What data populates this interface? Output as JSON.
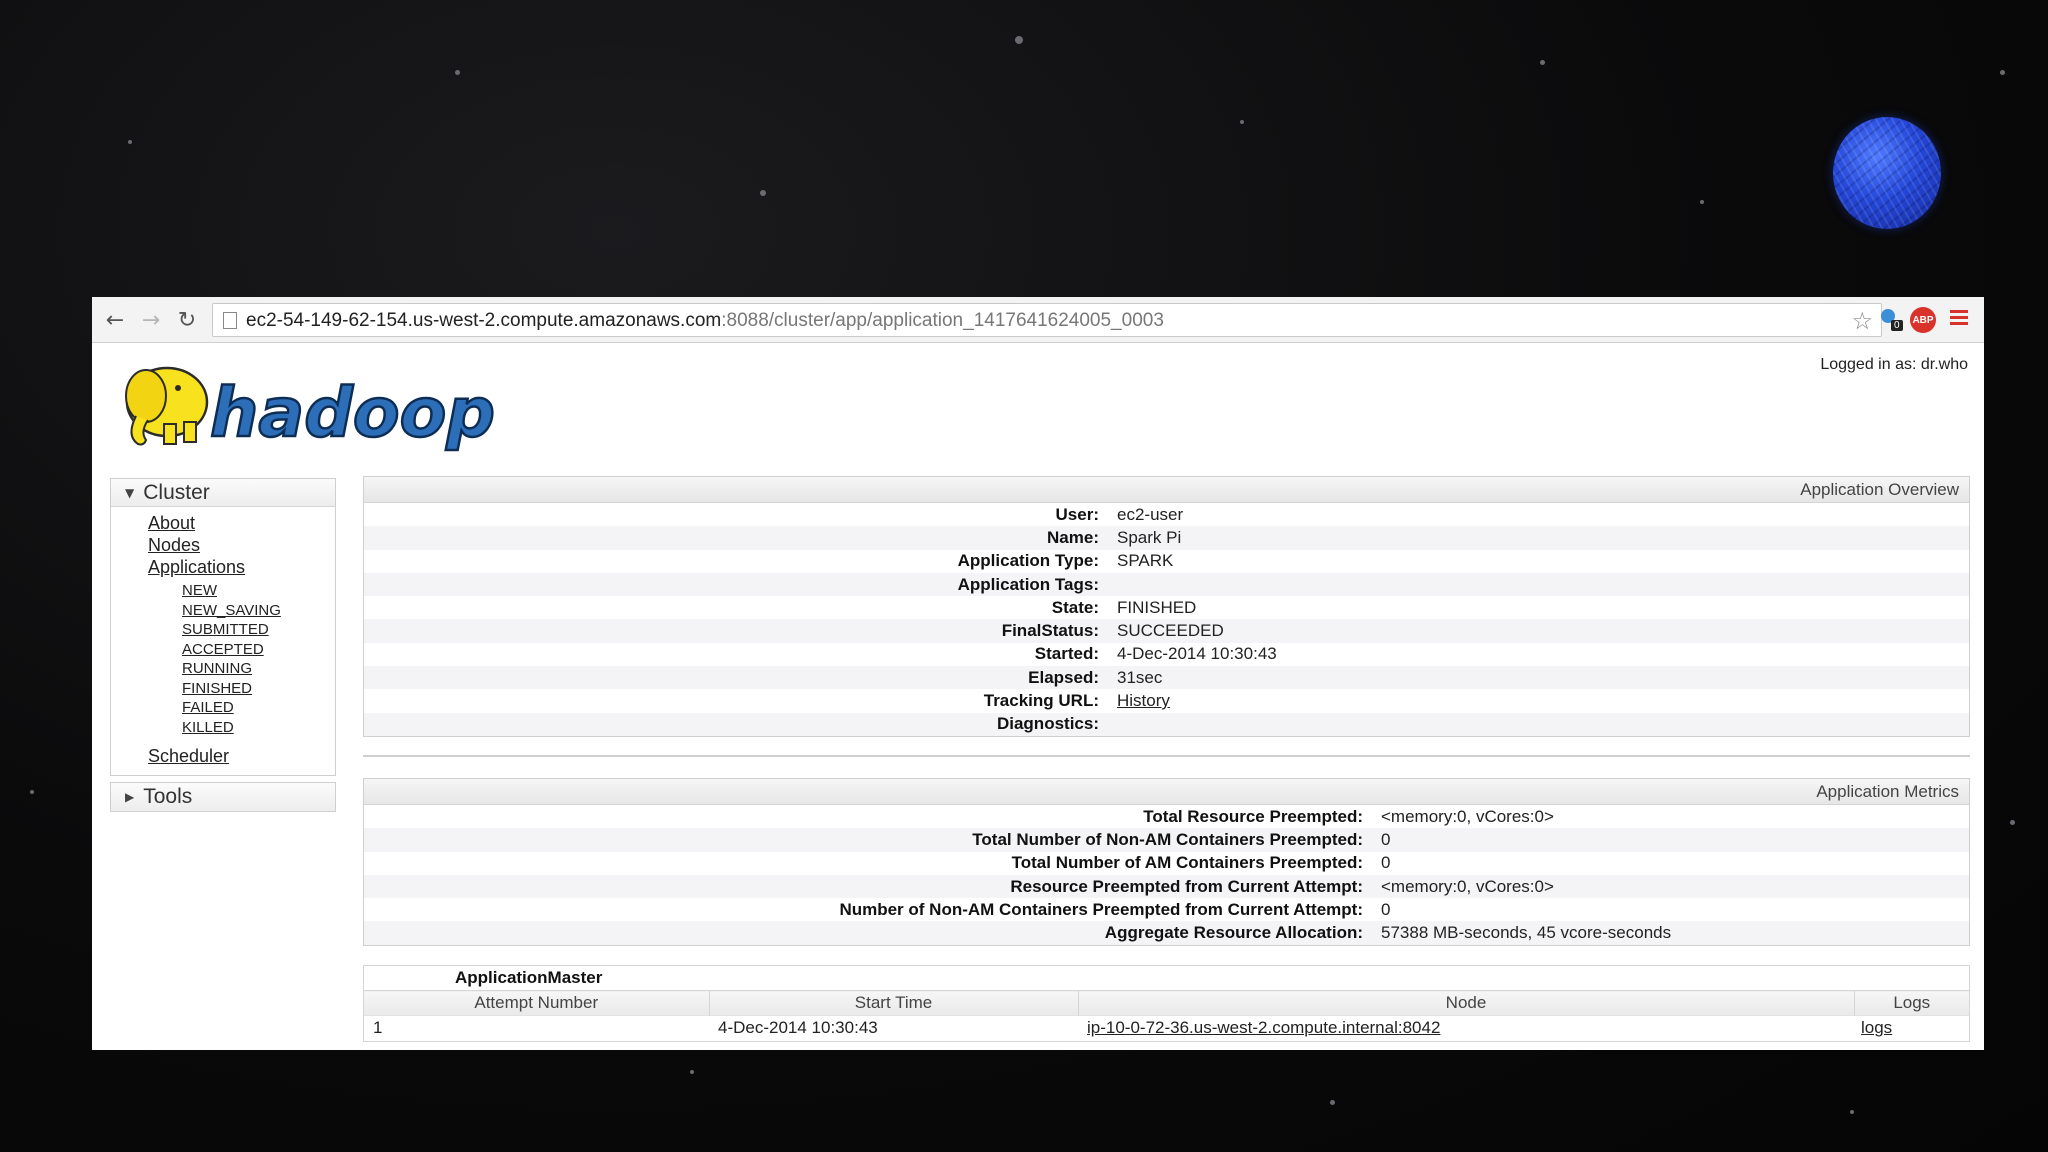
{
  "browser": {
    "url_host": "ec2-54-149-62-154.us-west-2.compute.amazonaws.com",
    "url_rest": ":8088/cluster/app/application_1417641624005_0003",
    "extension_badge": "0",
    "extension_abp": "ABP"
  },
  "header": {
    "logged_in": "Logged in as: dr.who",
    "logo_text": "hadoop"
  },
  "sidebar": {
    "cluster_label": "Cluster",
    "cluster_links": [
      "About",
      "Nodes",
      "Applications"
    ],
    "app_states": [
      "NEW",
      "NEW_SAVING",
      "SUBMITTED",
      "ACCEPTED",
      "RUNNING",
      "FINISHED",
      "FAILED",
      "KILLED"
    ],
    "scheduler_label": "Scheduler",
    "tools_label": "Tools"
  },
  "overview": {
    "title": "Application Overview",
    "rows": [
      {
        "label": "User:",
        "value": "ec2-user"
      },
      {
        "label": "Name:",
        "value": "Spark Pi"
      },
      {
        "label": "Application Type:",
        "value": "SPARK"
      },
      {
        "label": "Application Tags:",
        "value": ""
      },
      {
        "label": "State:",
        "value": "FINISHED"
      },
      {
        "label": "FinalStatus:",
        "value": "SUCCEEDED"
      },
      {
        "label": "Started:",
        "value": "4-Dec-2014 10:30:43"
      },
      {
        "label": "Elapsed:",
        "value": "31sec"
      },
      {
        "label": "Tracking URL:",
        "value": "History"
      },
      {
        "label": "Diagnostics:",
        "value": ""
      }
    ]
  },
  "metrics": {
    "title": "Application Metrics",
    "rows": [
      {
        "label": "Total Resource Preempted:",
        "value": "<memory:0, vCores:0>"
      },
      {
        "label": "Total Number of Non-AM Containers Preempted:",
        "value": "0"
      },
      {
        "label": "Total Number of AM Containers Preempted:",
        "value": "0"
      },
      {
        "label": "Resource Preempted from Current Attempt:",
        "value": "<memory:0, vCores:0>"
      },
      {
        "label": "Number of Non-AM Containers Preempted from Current Attempt:",
        "value": "0"
      },
      {
        "label": "Aggregate Resource Allocation:",
        "value": "57388 MB-seconds, 45 vcore-seconds"
      }
    ]
  },
  "app_master": {
    "title": "ApplicationMaster",
    "columns": [
      "Attempt Number",
      "Start Time",
      "Node",
      "Logs"
    ],
    "rows": [
      {
        "attempt": "1",
        "start": "4-Dec-2014 10:30:43",
        "node": "ip-10-0-72-36.us-west-2.compute.internal:8042",
        "logs": "logs"
      }
    ]
  }
}
